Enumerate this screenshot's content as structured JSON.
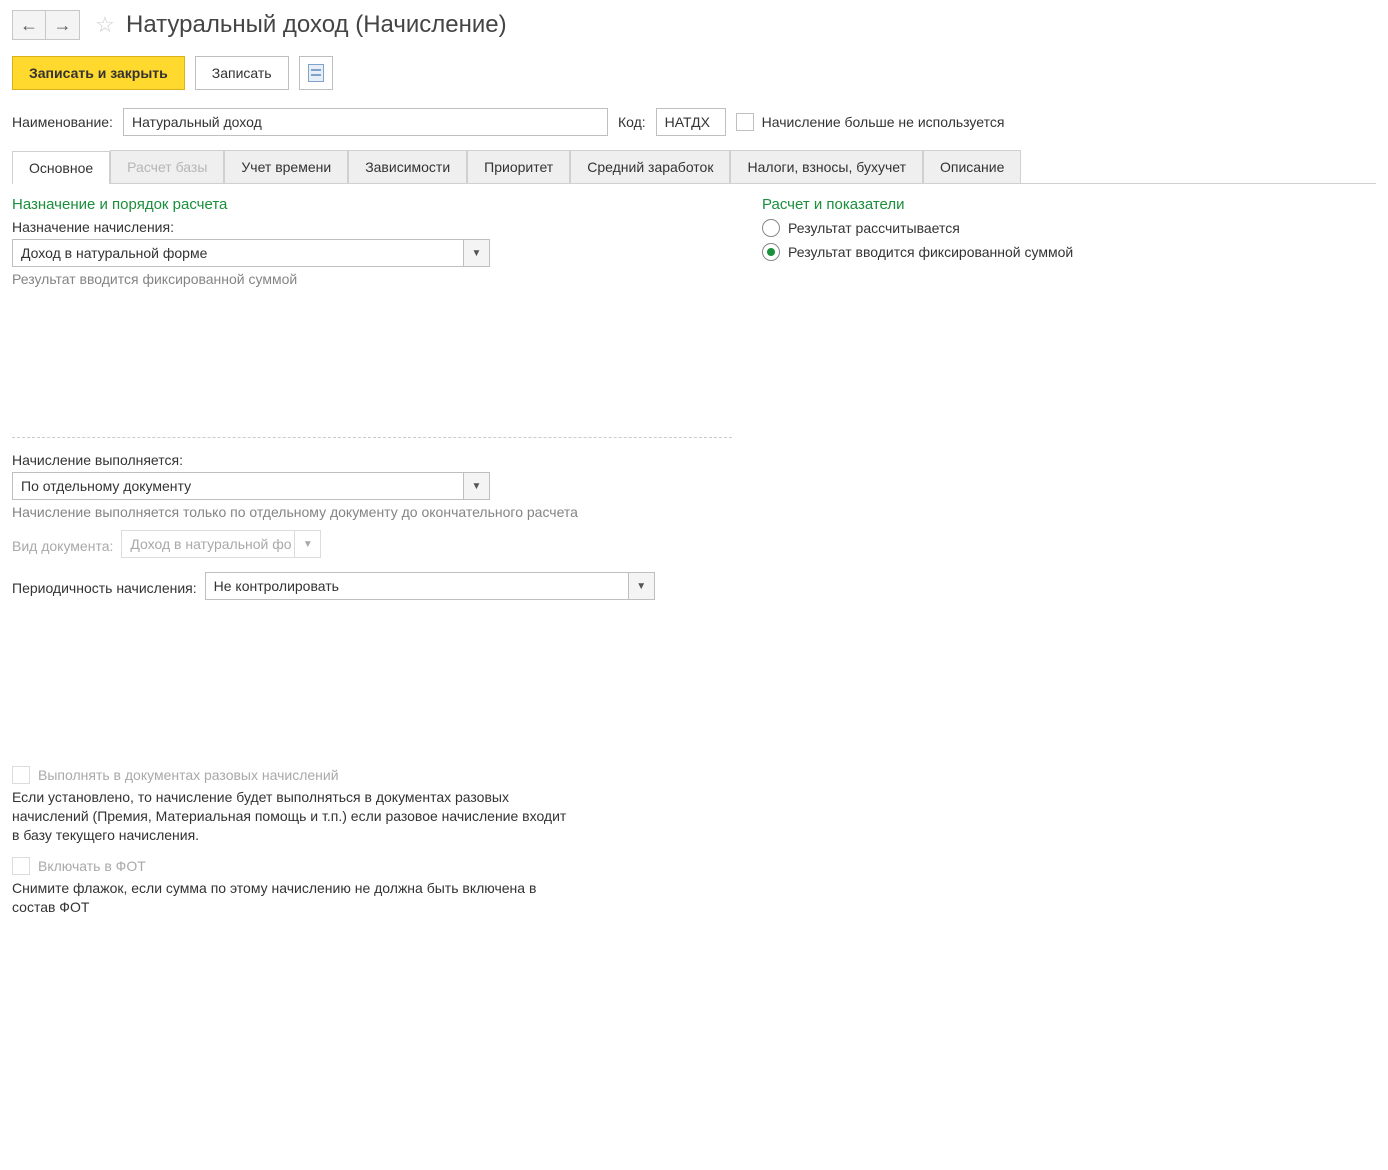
{
  "header": {
    "title": "Натуральный доход (Начисление)"
  },
  "toolbar": {
    "save_close": "Записать и закрыть",
    "save": "Записать"
  },
  "name_row": {
    "name_label": "Наименование:",
    "name_value": "Натуральный доход",
    "code_label": "Код:",
    "code_value": "НАТДХ",
    "inactive_label": "Начисление больше не используется",
    "inactive_checked": false
  },
  "tabs": [
    {
      "label": "Основное",
      "active": true,
      "disabled": false
    },
    {
      "label": "Расчет базы",
      "active": false,
      "disabled": true
    },
    {
      "label": "Учет времени",
      "active": false,
      "disabled": false
    },
    {
      "label": "Зависимости",
      "active": false,
      "disabled": false
    },
    {
      "label": "Приоритет",
      "active": false,
      "disabled": false
    },
    {
      "label": "Средний заработок",
      "active": false,
      "disabled": false
    },
    {
      "label": "Налоги, взносы, бухучет",
      "active": false,
      "disabled": false
    },
    {
      "label": "Описание",
      "active": false,
      "disabled": false
    }
  ],
  "left": {
    "section1_title": "Назначение и порядок расчета",
    "purpose_label": "Назначение начисления:",
    "purpose_value": "Доход в натуральной форме",
    "purpose_hint": "Результат вводится фиксированной суммой",
    "exec_label": "Начисление выполняется:",
    "exec_value": "По отдельному документу",
    "exec_hint": "Начисление выполняется только по отдельному документу до окончательного расчета",
    "doc_type_label": "Вид документа:",
    "doc_type_value": "Доход в натуральной фо",
    "period_label": "Периодичность начисления:",
    "period_value": "Не контролировать",
    "chk_oneoff": "Выполнять в документах разовых начислений",
    "chk_oneoff_hint": "Если установлено, то начисление будет выполняться в документах разовых начислений (Премия, Материальная помощь и т.п.) если разовое начисление входит в базу текущего начисления.",
    "chk_fot": "Включать в ФОТ",
    "chk_fot_hint": "Снимите флажок, если сумма по этому начислению не должна быть включена в состав ФОТ"
  },
  "right": {
    "title": "Расчет и показатели",
    "opt1": "Результат рассчитывается",
    "opt2": "Результат вводится фиксированной суммой",
    "selected": "opt2"
  },
  "colors": {
    "accent_green": "#1a8f3c",
    "primary_yellow": "#ffd92e"
  }
}
